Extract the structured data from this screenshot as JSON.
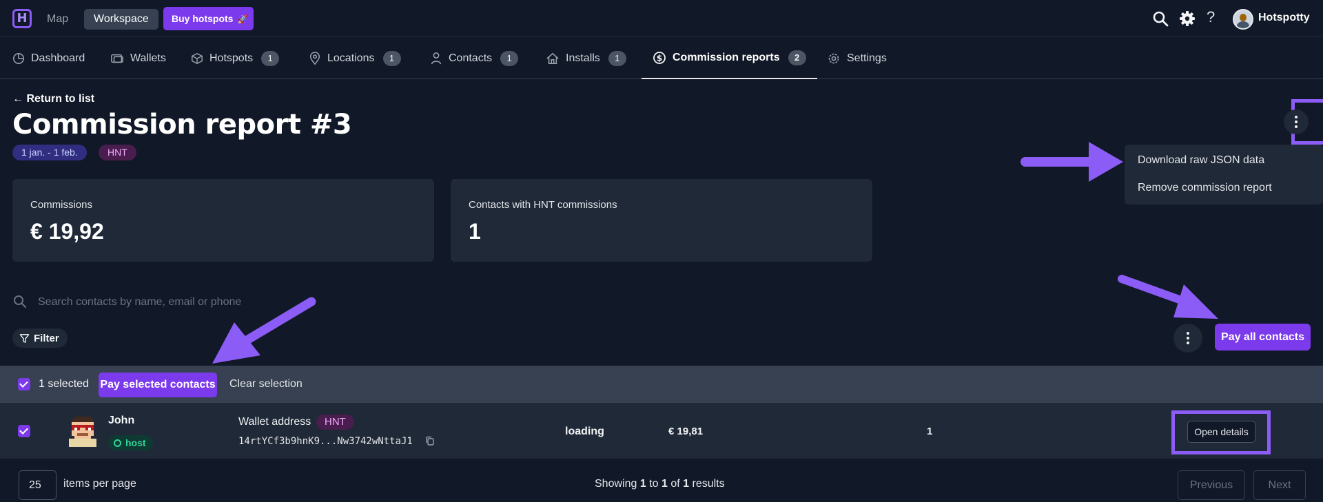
{
  "topbar": {
    "logo_letter": "H",
    "nav_map": "Map",
    "nav_workspace": "Workspace",
    "buy_label": "Buy hotspots",
    "buy_icon": "🚀",
    "help": "?",
    "user_name": "Hotspotty"
  },
  "tabs": [
    {
      "label": "Dashboard",
      "icon": "chart-pie-icon"
    },
    {
      "label": "Wallets",
      "icon": "wallet-icon"
    },
    {
      "label": "Hotspots",
      "icon": "cube-icon",
      "badge": "1"
    },
    {
      "label": "Locations",
      "icon": "map-pin-icon",
      "badge": "1"
    },
    {
      "label": "Contacts",
      "icon": "user-icon",
      "badge": "1"
    },
    {
      "label": "Installs",
      "icon": "home-icon",
      "badge": "1"
    },
    {
      "label": "Commission reports",
      "icon": "dollar-circle-icon",
      "badge": "2",
      "active": true
    },
    {
      "label": "Settings",
      "icon": "gear-icon"
    }
  ],
  "header": {
    "back": "← Return to list",
    "title": "Commission report #3",
    "date_range": "1 jan. - 1 feb.",
    "token": "HNT"
  },
  "menu": {
    "download": "Download raw JSON data",
    "remove": "Remove commission report"
  },
  "cards": [
    {
      "label": "Commissions",
      "value": "€ 19,92"
    },
    {
      "label": "Contacts with HNT commissions",
      "value": "1"
    }
  ],
  "search": {
    "placeholder": "Search contacts by name, email or phone"
  },
  "filter_label": "Filter",
  "pay_all_label": "Pay all contacts",
  "selection": {
    "count_label": "1 selected",
    "pay_selected": "Pay selected contacts",
    "clear": "Clear selection"
  },
  "rows": [
    {
      "name": "John",
      "role": "host",
      "wallet_label": "Wallet address",
      "wallet_token": "HNT",
      "wallet_address": "14rtYCf3b9hnK9...Nw3742wNttaJ1",
      "status": "loading",
      "amount": "€ 19,81",
      "count": "1",
      "action": "Open details"
    }
  ],
  "pagination": {
    "per_page": "25",
    "per_page_label": "items per page",
    "showing_pre": "Showing",
    "from": "1",
    "to_word": "to",
    "to": "1",
    "of_word": "of",
    "total": "1",
    "results_word": "results",
    "prev": "Previous",
    "next": "Next"
  },
  "colors": {
    "background": "#111827",
    "panel": "#1f2937",
    "accent": "#7c3aed",
    "highlight": "#8b5cf6"
  }
}
